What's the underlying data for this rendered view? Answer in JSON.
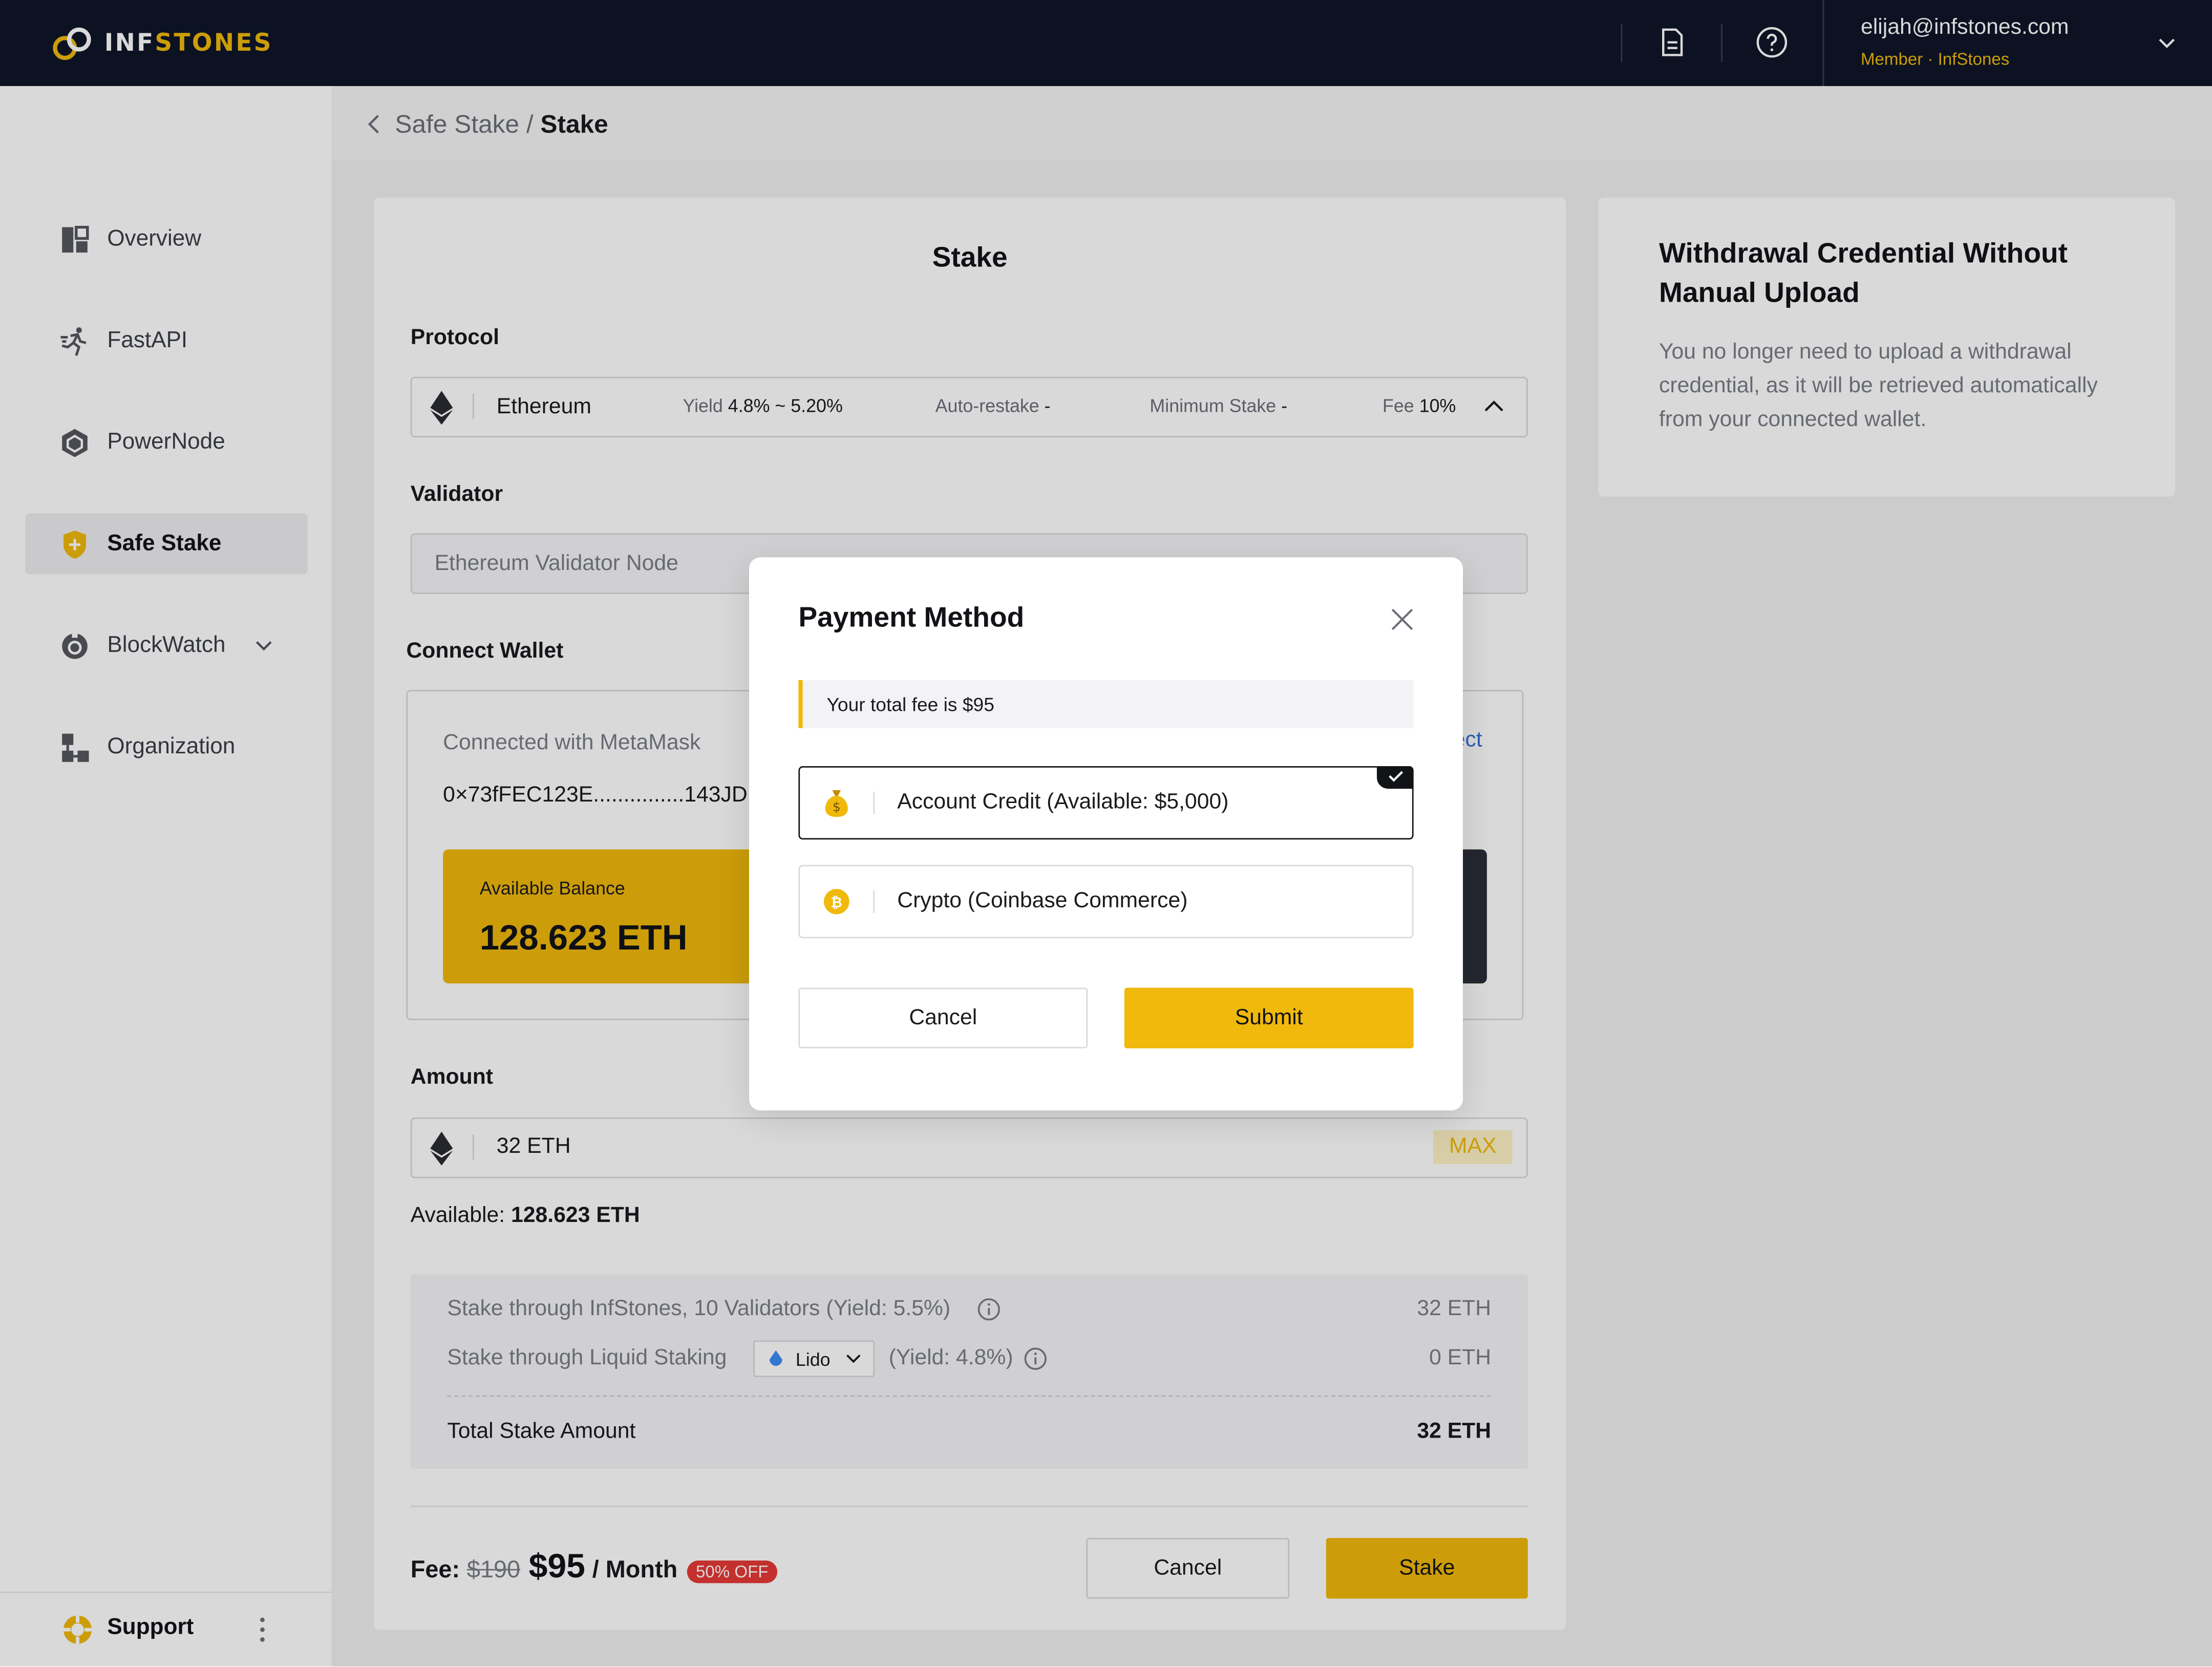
{
  "brand": {
    "name_a": "INF",
    "name_b": "STONES",
    "accent": "#f0b90b",
    "topbar_bg": "#0f1629"
  },
  "header": {
    "user_email": "elijah@infstones.com",
    "user_role": "Member · InfStones",
    "icons": [
      "document-icon",
      "help-icon",
      "chevron-down-icon"
    ]
  },
  "sidebar": {
    "items": [
      {
        "label": "Overview",
        "icon": "overview-icon"
      },
      {
        "label": "FastAPI",
        "icon": "fastapi-icon"
      },
      {
        "label": "PowerNode",
        "icon": "powernode-icon"
      },
      {
        "label": "Safe Stake",
        "icon": "safe-stake-icon",
        "active": true
      },
      {
        "label": "BlockWatch",
        "icon": "blockwatch-icon",
        "has_submenu": true
      },
      {
        "label": "Organization",
        "icon": "organization-icon"
      }
    ],
    "support_label": "Support"
  },
  "breadcrumb": {
    "parent": "Safe Stake",
    "separator": "/",
    "current": "Stake"
  },
  "stake": {
    "title": "Stake",
    "protocol_label": "Protocol",
    "protocol": {
      "name": "Ethereum",
      "yield_label": "Yield",
      "yield_value": "4.8% ~ 5.20%",
      "autorestake_label": "Auto-restake",
      "autorestake_value": "-",
      "minstake_label": "Minimum Stake",
      "minstake_value": "-",
      "fee_label": "Fee",
      "fee_value": "10%"
    },
    "validator_label": "Validator",
    "validator_value": "Ethereum Validator Node",
    "wallet_label": "Connect Wallet",
    "wallet": {
      "connected_text": "Connected with MetaMask",
      "address": "0×73fFEC123E...............143JD",
      "disconnect_partial": "ect",
      "balance_label": "Available Balance",
      "balance_value": "128.623 ETH"
    },
    "amount_label": "Amount",
    "amount_value": "32 ETH",
    "max_label": "MAX",
    "available_label": "Available:",
    "available_value": "128.623 ETH",
    "breakdown": {
      "row1_label": "Stake through InfStones, 10 Validators (Yield: 5.5%)",
      "row1_value": "32 ETH",
      "row2_label": "Stake through Liquid Staking",
      "row2_provider": "Lido",
      "row2_yield": "(Yield: 4.8%)",
      "row2_value": "0 ETH",
      "total_label": "Total Stake Amount",
      "total_value": "32 ETH"
    },
    "fee": {
      "label": "Fee:",
      "old": "$190",
      "new": "$95",
      "period": "/ Month",
      "discount": "50% OFF"
    },
    "cancel_label": "Cancel",
    "stake_label": "Stake"
  },
  "info": {
    "title": "Withdrawal Credential Without Manual Upload",
    "text": "You no longer need to upload a withdrawal credential, as it will be retrieved automatically from your connected wallet."
  },
  "modal": {
    "title": "Payment Method",
    "fee_notice": "Your total fee is $95",
    "option1": "Account Credit (Available: $5,000)",
    "option2": "Crypto (Coinbase Commerce)",
    "cancel_label": "Cancel",
    "submit_label": "Submit"
  }
}
